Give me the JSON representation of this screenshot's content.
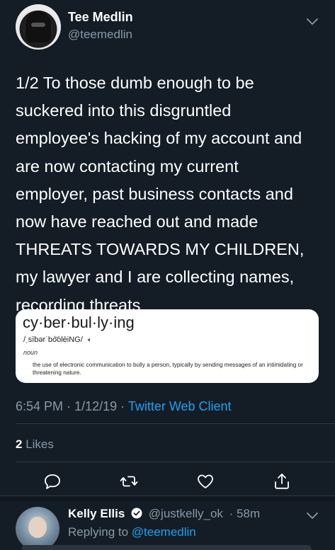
{
  "tweet": {
    "author_name": "Tee Medlin",
    "author_handle": "@teemedlin",
    "text_lines": [
      "1/2 To those dumb enough to be",
      "suckered into this disgruntled",
      "employee's hacking of my account and",
      "are now contacting my current",
      "employer, past business contacts and",
      "now have reached out and made",
      "THREATS TOWARDS MY CHILDREN,",
      "my lawyer and I are collecting names,",
      "recording threats"
    ],
    "time": "6:54 PM",
    "date": "1/12/19",
    "dot": "·",
    "client": "Twitter Web Client",
    "likes_count": "2",
    "likes_label": "Likes"
  },
  "card": {
    "word": "cy·ber·bul·ly·ing",
    "pronunciation": "/ˌsībərˈbo͝olēiNG/",
    "part_of_speech": "noun",
    "definition": "the use of electronic communication to bully a person, typically by sending messages of an intimidating or threatening nature."
  },
  "reply": {
    "author_name": "Kelly Ellis",
    "author_handle": "@justkelly_ok",
    "time_ago": "· 58m",
    "replying_prefix": "Replying to",
    "replying_to": "@teemedlin"
  },
  "icons": {
    "chevron": "chevron-down-icon",
    "reply": "reply-icon",
    "retweet": "retweet-icon",
    "like": "heart-icon",
    "share": "share-icon",
    "verified": "verified-badge-icon",
    "speaker": "speaker-icon"
  },
  "colors": {
    "background": "#141d26",
    "muted": "#8899a6",
    "link": "#1da1f2"
  }
}
